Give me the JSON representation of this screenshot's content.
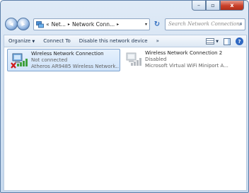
{
  "window": {
    "caption": {
      "minimize": "–",
      "maximize": "▫",
      "close": "x"
    }
  },
  "address_bar": {
    "overflow": "«",
    "segments": [
      "Net...",
      "Network Conn..."
    ],
    "separator": "▸",
    "dropdown": "▾"
  },
  "search": {
    "placeholder": "Search Network Connections"
  },
  "toolbar": {
    "organize_label": "Organize",
    "connect_label": "Connect To",
    "disable_label": "Disable this network device",
    "more_label": "»",
    "help_label": "?"
  },
  "connections": [
    {
      "name": "Wireless Network Connection",
      "status": "Not connected",
      "adapter": "Atheros AR9485 Wireless Network...",
      "selected": true
    },
    {
      "name": "Wireless Network Connection 2",
      "status": "Disabled",
      "adapter": "Microsoft Virtual WiFi Miniport A...",
      "selected": false
    }
  ],
  "icons": {
    "back": "back-arrow-icon",
    "forward": "forward-arrow-icon",
    "refresh": "refresh-icon",
    "search": "search-icon",
    "error_badge": "red-x-icon",
    "signal": "signal-bars-icon"
  }
}
